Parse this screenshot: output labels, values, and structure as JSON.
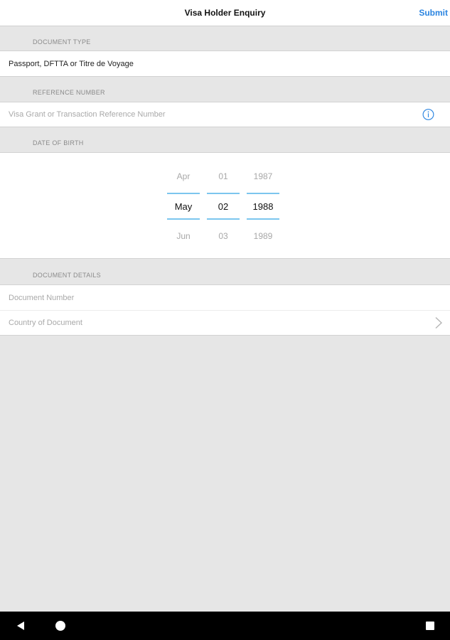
{
  "header": {
    "title": "Visa Holder Enquiry",
    "submit_label": "Submit"
  },
  "document_type": {
    "section_label": "DOCUMENT TYPE",
    "value": "Passport, DFTTA or Titre de Voyage"
  },
  "reference_number": {
    "section_label": "REFERENCE NUMBER",
    "placeholder": "Visa Grant or Transaction Reference Number",
    "icon": "info-icon"
  },
  "date_of_birth": {
    "section_label": "DATE OF BIRTH",
    "month": {
      "prev": "Apr",
      "selected": "May",
      "next": "Jun"
    },
    "day": {
      "prev": "01",
      "selected": "02",
      "next": "03"
    },
    "year": {
      "prev": "1987",
      "selected": "1988",
      "next": "1989"
    }
  },
  "document_details": {
    "section_label": "DOCUMENT DETAILS",
    "document_number_placeholder": "Document Number",
    "country_placeholder": "Country of Document",
    "country_icon": "chevron-right-icon"
  },
  "system_nav": {
    "back_icon": "back-icon",
    "home_icon": "home-icon",
    "recents_icon": "recents-icon"
  },
  "colors": {
    "accent": "#2a84e0",
    "picker_line": "#7cc6ee",
    "background": "#e6e6e6"
  }
}
